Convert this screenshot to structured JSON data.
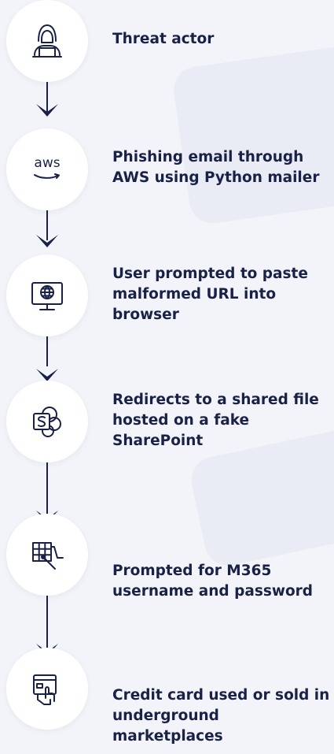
{
  "steps": [
    {
      "label": "Threat actor",
      "icon": "hacker-icon"
    },
    {
      "label": "Phishing email through AWS using Python mailer",
      "icon": "aws-logo-icon",
      "icon_text": "aws"
    },
    {
      "label": "User prompted to paste malformed URL into browser",
      "icon": "web-monitor-icon"
    },
    {
      "label": "Redirects to a shared file hosted on a fake SharePoint",
      "icon": "sharepoint-icon"
    },
    {
      "label": "Prompted for M365 username and password",
      "icon": "password-grid-icon"
    },
    {
      "label": "Credit card used or sold in underground marketplaces",
      "icon": "card-reader-icon"
    }
  ],
  "colors": {
    "text": "#1a2147",
    "background": "#f2f4f9",
    "circle": "#ffffff"
  }
}
